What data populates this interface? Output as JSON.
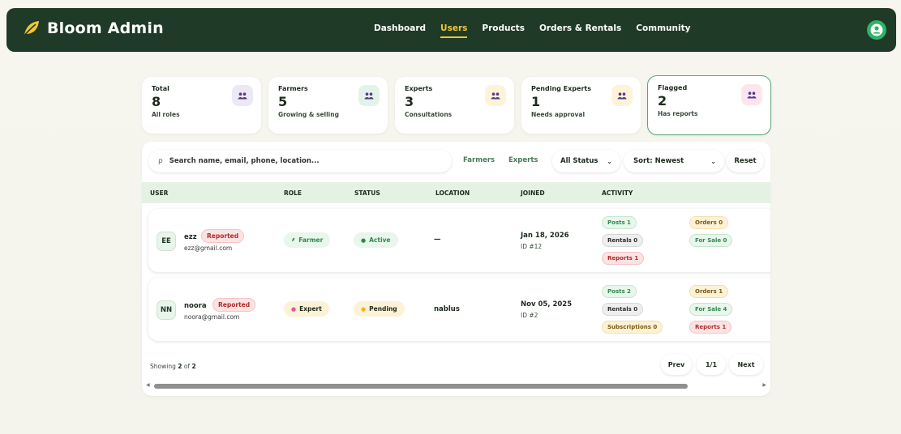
{
  "brand": {
    "name": "Bloom Admin"
  },
  "nav": {
    "links": [
      {
        "label": "Dashboard",
        "active": false
      },
      {
        "label": "Users",
        "active": true
      },
      {
        "label": "Products",
        "active": false
      },
      {
        "label": "Orders & Rentals",
        "active": false
      },
      {
        "label": "Community",
        "active": false
      }
    ],
    "user_icon": "user-circle-icon"
  },
  "stats": [
    {
      "label": "Total",
      "value": "8",
      "sub": "All roles",
      "icon": "users-icon",
      "color": "#ece8f4"
    },
    {
      "label": "Farmers",
      "value": "5",
      "sub": "Growing & selling",
      "icon": "users-icon",
      "color": "#e3f3ea"
    },
    {
      "label": "Experts",
      "value": "3",
      "sub": "Consultations",
      "icon": "users-icon",
      "color": "#fdf3d8"
    },
    {
      "label": "Pending Experts",
      "value": "1",
      "sub": "Needs approval",
      "icon": "users-icon",
      "color": "#fdf3d8"
    },
    {
      "label": "Flagged",
      "value": "2",
      "sub": "Has reports",
      "icon": "users-icon",
      "color": "#fbe6ee"
    }
  ],
  "toolbar": {
    "search_placeholder": "Search name, email, phone, location...",
    "filter_farmers": "Farmers",
    "filter_experts": "Experts",
    "status_select": "All Status",
    "sort_select": "Sort: Newest",
    "reset": "Reset"
  },
  "table": {
    "columns": [
      "USER",
      "ROLE",
      "STATUS",
      "LOCATION",
      "JOINED",
      "ACTIVITY"
    ],
    "rows": [
      {
        "initials": "EE",
        "name": "ezz",
        "flag": "Reported",
        "email": "ezz@gmail.com",
        "role": "Farmer",
        "status": "Active",
        "location": "—",
        "joined": "Jan 18, 2026",
        "id": "ID #12",
        "activity_left": [
          "Posts 1",
          "Rentals 0",
          "Reports 1"
        ],
        "activity_right": [
          "Orders 0",
          "For Sale 0"
        ]
      },
      {
        "initials": "NN",
        "name": "noora",
        "flag": "Reported",
        "email": "noora@gmail.com",
        "role": "Expert",
        "status": "Pending",
        "location": "nablus",
        "joined": "Nov 05, 2025",
        "id": "ID #2",
        "activity_left": [
          "Posts 2",
          "Rentals 0",
          "Subscriptions 0"
        ],
        "activity_right": [
          "Orders 1",
          "For Sale 4",
          "Reports 1"
        ]
      }
    ]
  },
  "footer": {
    "showing_prefix": "Showing ",
    "showing_count": "2",
    "showing_of": " of ",
    "showing_total": "2",
    "prev": "Prev",
    "page": "1/1",
    "next": "Next"
  }
}
